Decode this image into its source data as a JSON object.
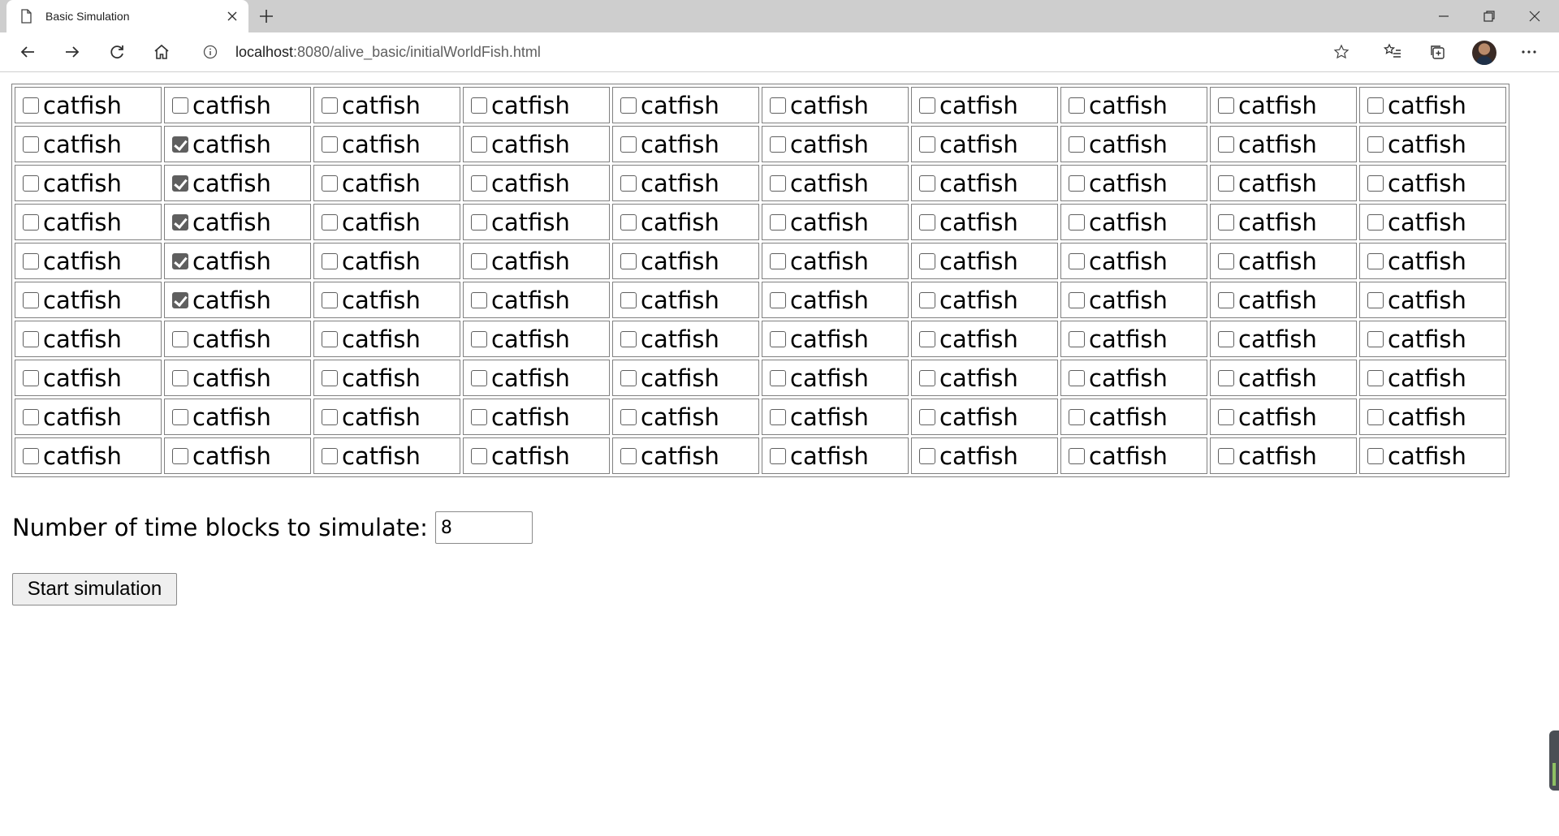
{
  "browser": {
    "tab_title": "Basic Simulation",
    "url_host": "localhost",
    "url_path": ":8080/alive_basic/initialWorldFish.html"
  },
  "grid": {
    "label": "catfish",
    "rows": 10,
    "cols": 10,
    "checked_cells": [
      [
        1,
        1
      ],
      [
        2,
        1
      ],
      [
        3,
        1
      ],
      [
        4,
        1
      ],
      [
        5,
        1
      ]
    ]
  },
  "form": {
    "label": "Number of time blocks to simulate:",
    "time_blocks_value": "8",
    "start_button": "Start simulation"
  }
}
